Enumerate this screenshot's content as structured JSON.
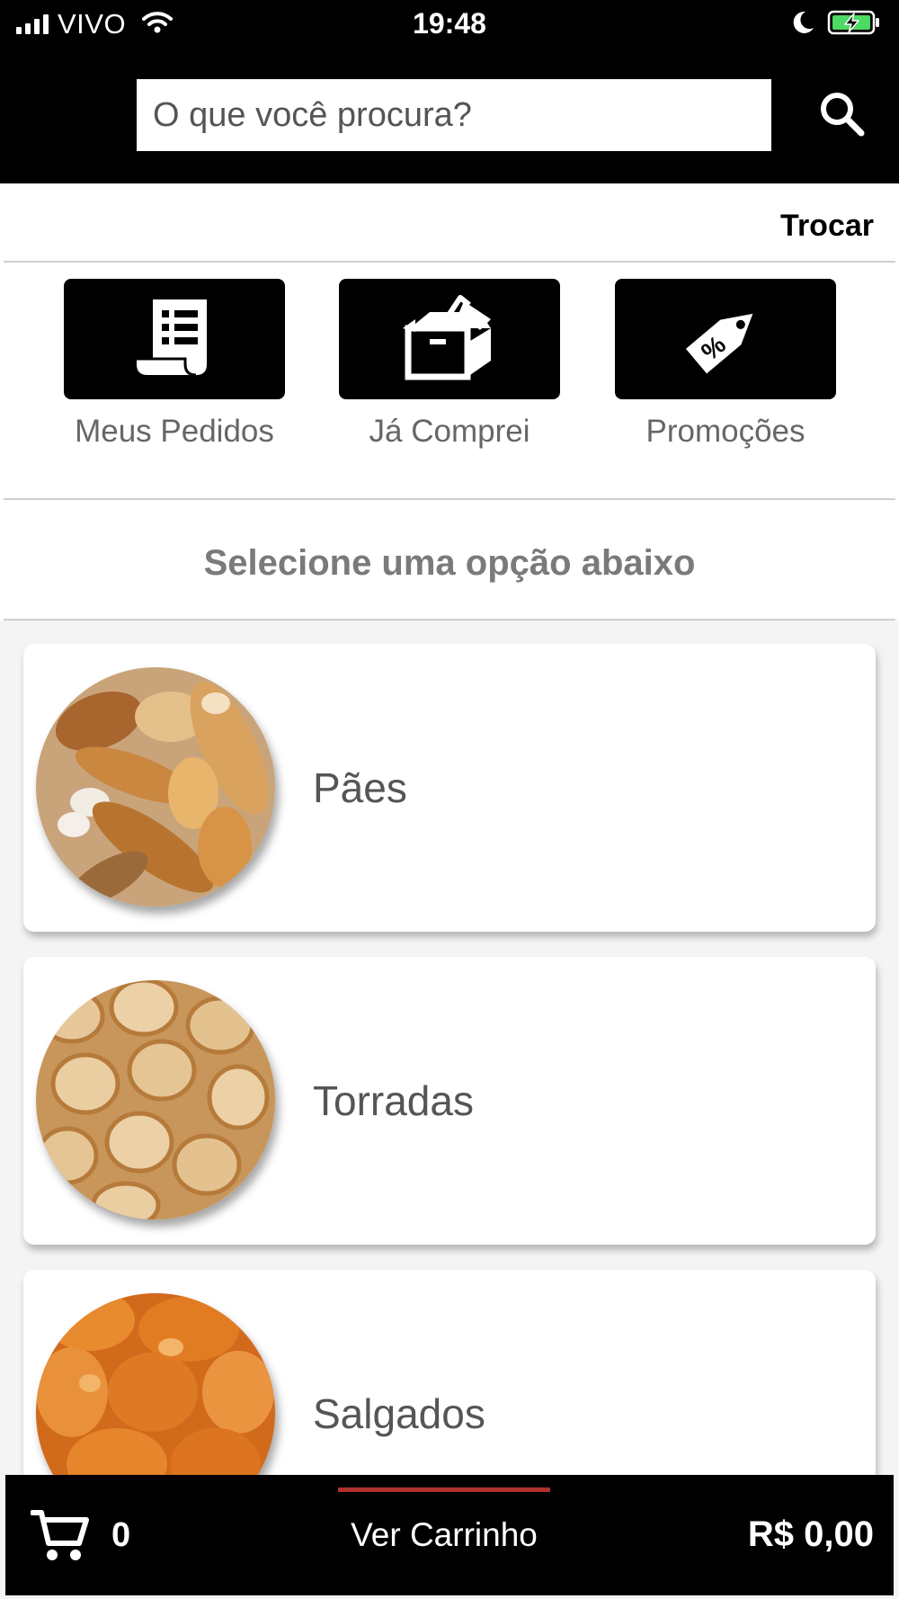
{
  "status_bar": {
    "carrier": "VIVO",
    "time": "19:48",
    "icons": [
      "signal-icon",
      "wifi-icon",
      "moon-icon",
      "battery-charging-icon"
    ]
  },
  "search": {
    "placeholder": "O que você procura?",
    "icon": "search-icon"
  },
  "location": {
    "change_label": "Trocar"
  },
  "quick_actions": [
    {
      "label": "Meus Pedidos",
      "icon": "receipt-icon"
    },
    {
      "label": "Já Comprei",
      "icon": "open-box-icon"
    },
    {
      "label": "Promoções",
      "icon": "discount-tag-icon"
    }
  ],
  "section_title": "Selecione uma opção abaixo",
  "categories": [
    {
      "label": "Pães"
    },
    {
      "label": "Torradas"
    },
    {
      "label": "Salgados"
    }
  ],
  "cart": {
    "icon": "cart-icon",
    "count": "0",
    "view_label": "Ver Carrinho",
    "total": "R$ 0,00",
    "accent_color": "#b03030"
  },
  "colors": {
    "header_bg": "#000000",
    "text_muted": "#666666"
  }
}
